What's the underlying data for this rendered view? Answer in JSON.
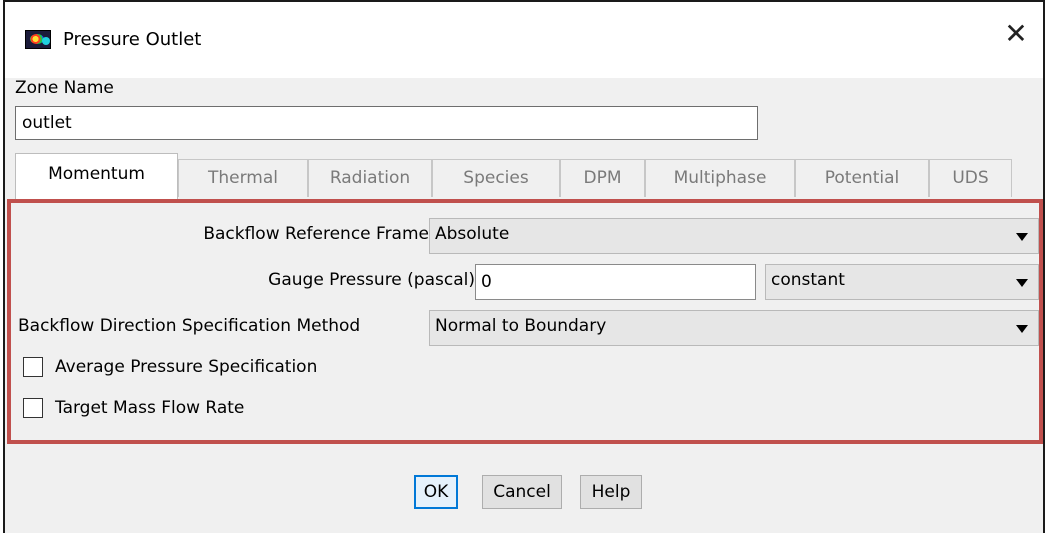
{
  "window": {
    "title": "Pressure Outlet",
    "icon": "fluent-app-icon",
    "close_icon": "close-icon"
  },
  "zone": {
    "label": "Zone Name",
    "value": "outlet"
  },
  "tabs": [
    {
      "label": "Momentum",
      "active": true
    },
    {
      "label": "Thermal",
      "active": false
    },
    {
      "label": "Radiation",
      "active": false
    },
    {
      "label": "Species",
      "active": false
    },
    {
      "label": "DPM",
      "active": false
    },
    {
      "label": "Multiphase",
      "active": false
    },
    {
      "label": "Potential",
      "active": false
    },
    {
      "label": "UDS",
      "active": false
    }
  ],
  "momentum": {
    "backflow_ref_frame": {
      "label": "Backflow Reference Frame",
      "value": "Absolute"
    },
    "gauge_pressure": {
      "label": "Gauge Pressure (pascal)",
      "value": "0",
      "profile": "constant"
    },
    "backflow_direction": {
      "label": "Backflow Direction Specification Method",
      "value": "Normal to Boundary"
    },
    "avg_pressure": {
      "label": "Average Pressure Specification",
      "checked": false
    },
    "target_mass_flow": {
      "label": "Target Mass Flow Rate",
      "checked": false
    }
  },
  "buttons": {
    "ok": "OK",
    "cancel": "Cancel",
    "help": "Help"
  },
  "colors": {
    "highlight_border": "#c0504d",
    "default_button_border": "#0078d7"
  }
}
